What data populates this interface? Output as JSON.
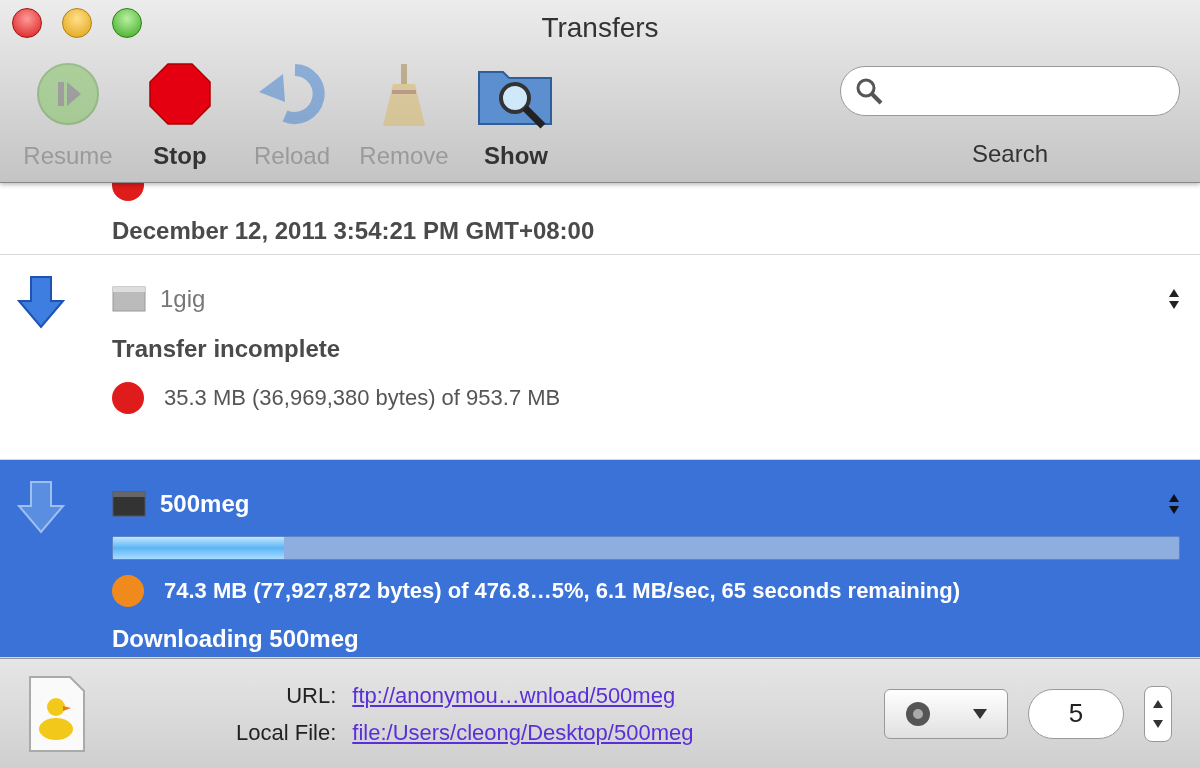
{
  "window": {
    "title": "Transfers"
  },
  "toolbar": [
    {
      "kind": "resume",
      "label": "Resume",
      "disabled": true
    },
    {
      "kind": "stop",
      "label": "Stop",
      "disabled": false
    },
    {
      "kind": "reload",
      "label": "Reload",
      "disabled": true
    },
    {
      "kind": "remove",
      "label": "Remove",
      "disabled": true
    },
    {
      "kind": "show",
      "label": "Show",
      "disabled": false
    }
  ],
  "search": {
    "label": "Search"
  },
  "transfers": [
    {
      "selected": false,
      "lines": [
        {
          "kind": "dot",
          "color": "#e01b1b"
        },
        {
          "kind": "text",
          "text": "December 12, 2011 3:54:21 PM GMT+08:00"
        }
      ]
    },
    {
      "selected": false,
      "name": "1gig",
      "lines": [
        {
          "kind": "text",
          "text": "Transfer incomplete"
        },
        {
          "kind": "dot",
          "color": "#e01b1b",
          "text": "35.3 MB (36,969,380 bytes) of 953.7 MB"
        }
      ]
    },
    {
      "selected": true,
      "name": "500meg",
      "lines": [
        {
          "kind": "bar",
          "level": 0.16
        },
        {
          "kind": "dot",
          "color": "#f08a1c",
          "text": "74.3 MB (77,927,872 bytes) of 476.8…5%, 6.1 MB/sec, 65 seconds remaining)"
        },
        {
          "kind": "text",
          "text": "Downloading 500meg"
        }
      ]
    }
  ],
  "details": {
    "url_label": "URL:",
    "url": "ftp://anonymou…wnload/500meg",
    "local_label": "Local File:",
    "local": "file:/Users/cleong/Desktop/500meg",
    "connections": "5"
  }
}
